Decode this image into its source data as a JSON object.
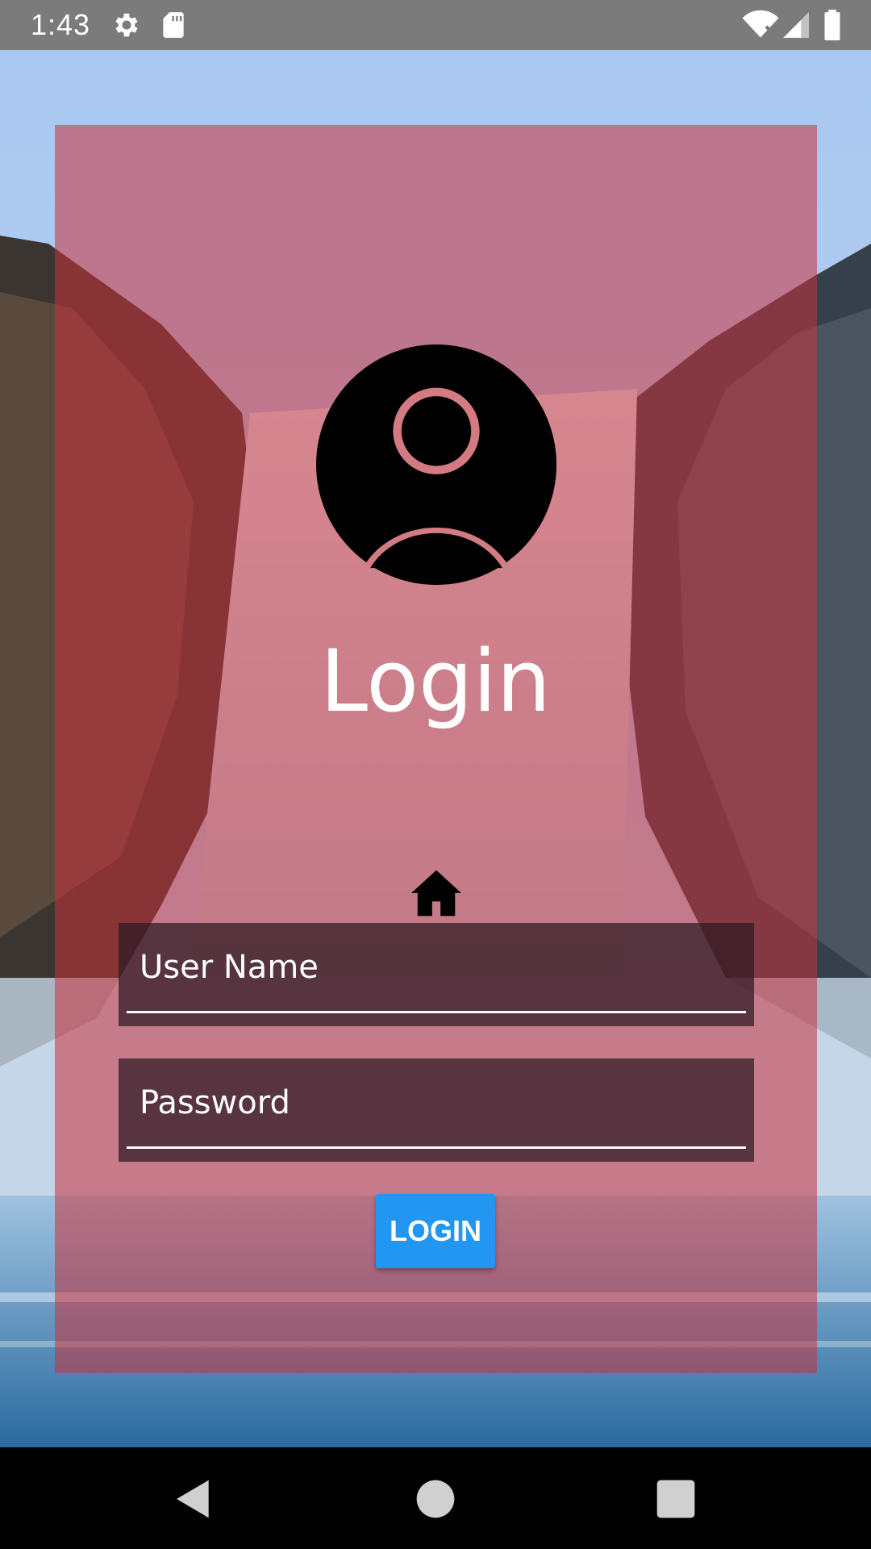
{
  "status_bar": {
    "time": "1:43",
    "icons": [
      "gear-icon",
      "sd-card-icon",
      "wifi-icon",
      "signal-icon",
      "battery-icon"
    ]
  },
  "login": {
    "title": "Login",
    "avatar_icon": "account-circle-icon",
    "home_icon": "home-icon",
    "username_placeholder": "User Name",
    "password_placeholder": "Password",
    "button_label": "LOGIN"
  },
  "colors": {
    "card_overlay": "#c8323c",
    "button": "#2196f3",
    "status_bar": "#7b7b7b"
  },
  "nav_bar": {
    "icons": [
      "back-icon",
      "home-nav-icon",
      "recents-icon"
    ]
  }
}
